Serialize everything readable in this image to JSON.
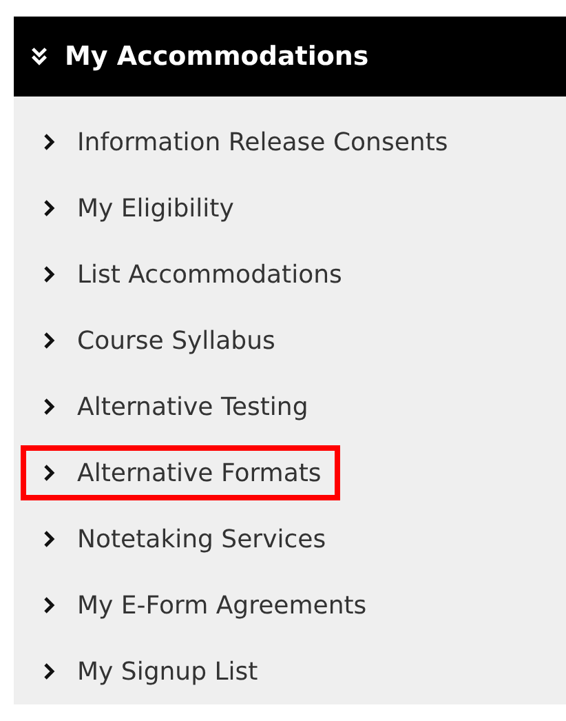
{
  "panel": {
    "title": "My Accommodations",
    "items": [
      {
        "label": "Information Release Consents",
        "highlighted": false
      },
      {
        "label": "My Eligibility",
        "highlighted": false
      },
      {
        "label": "List Accommodations",
        "highlighted": false
      },
      {
        "label": "Course Syllabus",
        "highlighted": false
      },
      {
        "label": "Alternative Testing",
        "highlighted": false
      },
      {
        "label": "Alternative Formats",
        "highlighted": true
      },
      {
        "label": "Notetaking Services",
        "highlighted": false
      },
      {
        "label": "My E-Form Agreements",
        "highlighted": false
      },
      {
        "label": "My Signup List",
        "highlighted": false
      }
    ]
  }
}
